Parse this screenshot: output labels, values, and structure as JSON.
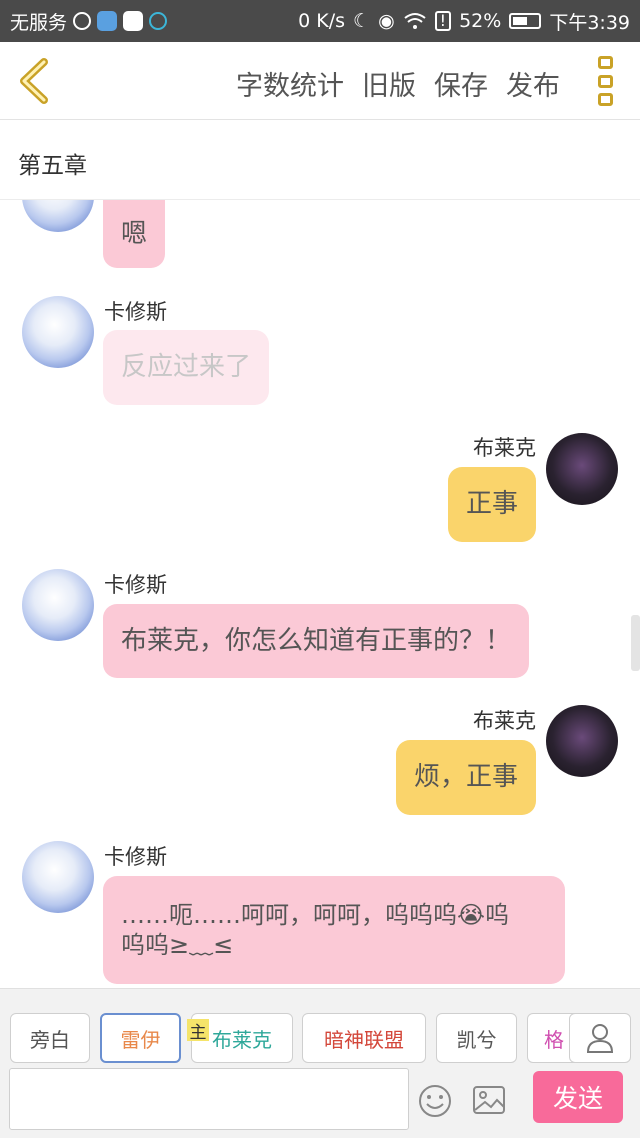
{
  "status_bar": {
    "carrier": "无服务",
    "network_speed": "0 K/s",
    "battery": "52%",
    "time": "下午3:39"
  },
  "nav": {
    "actions": [
      "字数统计",
      "旧版",
      "保存",
      "发布"
    ]
  },
  "chapter_title": "第五章",
  "messages": [
    {
      "side": "left",
      "name": "",
      "text": "嗯",
      "bubble": "pink"
    },
    {
      "side": "left",
      "name": "卡修斯",
      "text": "反应过来了",
      "bubble": "pinklight"
    },
    {
      "side": "right",
      "name": "布莱克",
      "text": "正事",
      "bubble": "yellow"
    },
    {
      "side": "left",
      "name": "卡修斯",
      "text": "布莱克，你怎么知道有正事的？！",
      "bubble": "pink"
    },
    {
      "side": "right",
      "name": "布莱克",
      "text": "烦，正事",
      "bubble": "yellow"
    },
    {
      "side": "left",
      "name": "卡修斯",
      "text_line1": "……呃……呵呵，呵呵，呜呜呜😭呜",
      "text_line2": "呜呜≥﹏≤",
      "bubble": "pink"
    }
  ],
  "characters": [
    {
      "label": "旁白",
      "color": "#555555"
    },
    {
      "label": "雷伊",
      "color": "#e8884a",
      "selected": true
    },
    {
      "label": "布莱克",
      "color": "#2fa89a"
    },
    {
      "label": "暗神联盟",
      "color": "#d3473a"
    },
    {
      "label": "凯兮",
      "color": "#555555"
    },
    {
      "label": "格",
      "color": "#d04fb0"
    }
  ],
  "main_tag": "主",
  "input": {
    "value": "",
    "placeholder": ""
  },
  "send_label": "发送"
}
